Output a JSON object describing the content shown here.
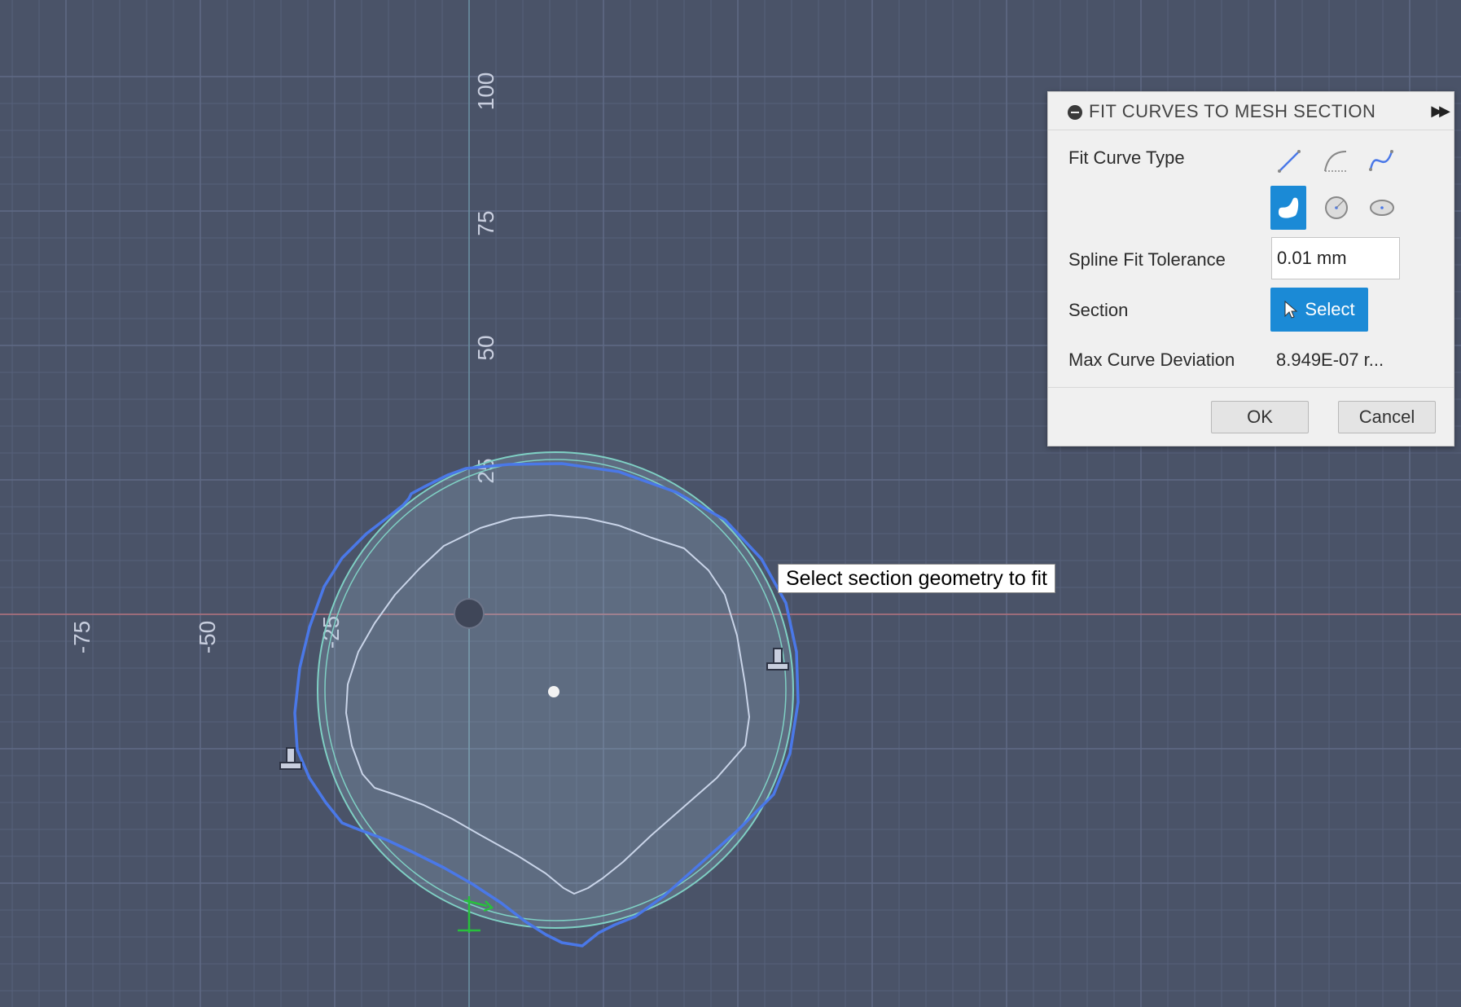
{
  "viewport": {
    "axis_labels": {
      "vertical": [
        "100",
        "75",
        "50",
        "25"
      ],
      "horizontal": [
        "-75",
        "-50",
        "-25"
      ]
    },
    "colors": {
      "background": "#4a5368",
      "grid_minor": "#56607a",
      "grid_major": "#5f6a85",
      "red_axis": "#b4707c",
      "green_axis": "#5f8a78",
      "fit_circle": "#7fd0c4",
      "fit_spline": "#4a78e8",
      "inner_section": "#c9d4e8"
    },
    "tooltip": "Select section geometry to fit"
  },
  "dialog": {
    "title": "FIT CURVES TO MESH SECTION",
    "collapse_icon": "collapse-icon",
    "expand_icon": "expand-icon",
    "fit_curve_type_label": "Fit Curve Type",
    "fit_curve_types": [
      {
        "icon": "line-fit-icon",
        "active": false
      },
      {
        "icon": "arc-fit-icon",
        "active": false
      },
      {
        "icon": "spline-fit-icon",
        "active": false
      },
      {
        "icon": "closed-spline-fit-icon",
        "active": true
      },
      {
        "icon": "circle-fit-icon",
        "active": false
      },
      {
        "icon": "ellipse-fit-icon",
        "active": false
      }
    ],
    "spline_fit_tolerance_label": "Spline Fit Tolerance",
    "spline_fit_tolerance_value": "0.01 mm",
    "section_label": "Section",
    "select_button": "Select",
    "max_curve_deviation_label": "Max Curve Deviation",
    "max_curve_deviation_value": "8.949E-07 r...",
    "ok_button": "OK",
    "cancel_button": "Cancel",
    "accent_color": "#1b8ad6"
  }
}
